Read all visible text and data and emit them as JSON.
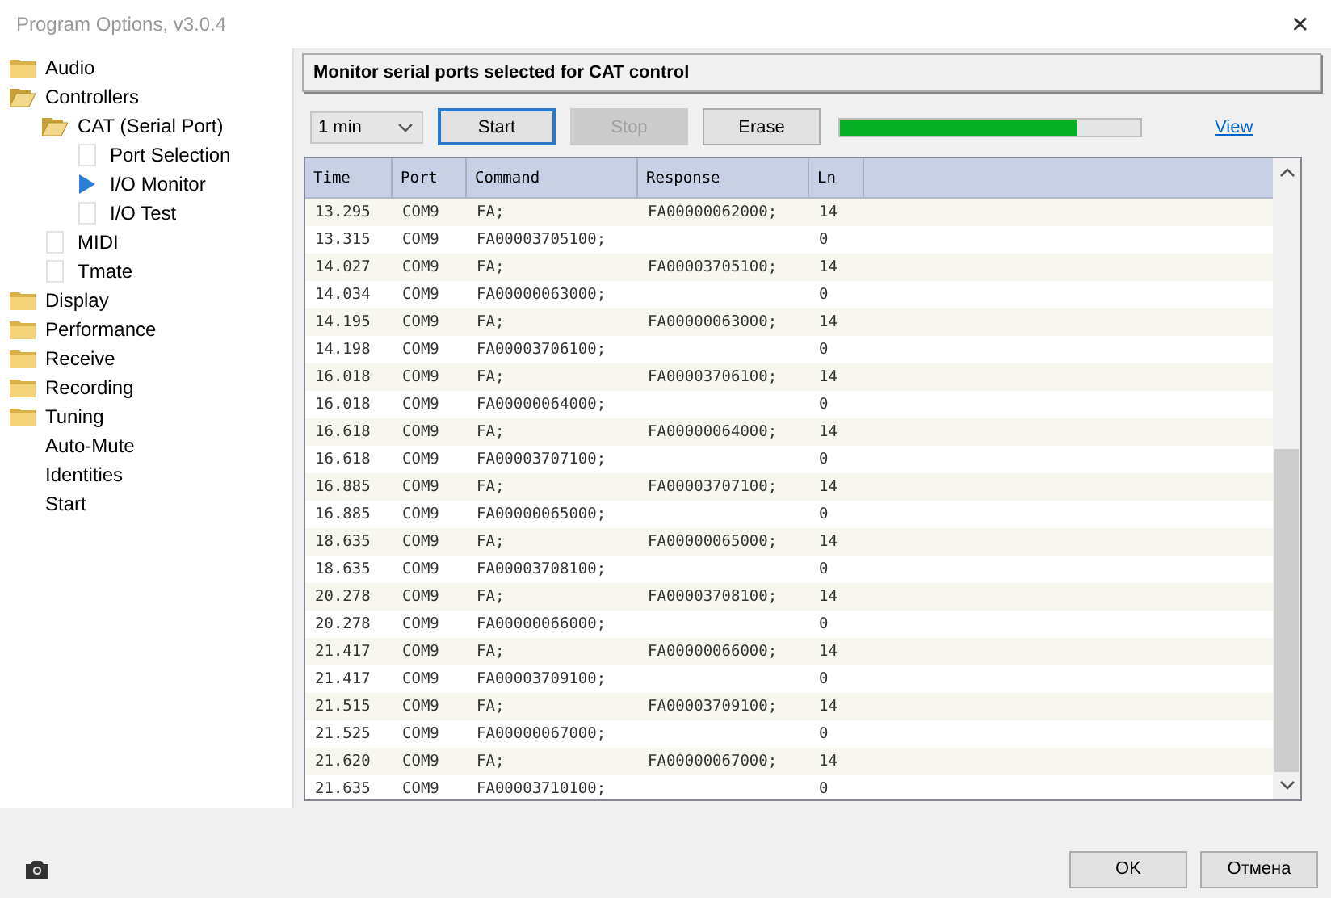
{
  "window": {
    "title": "Program Options, v3.0.4",
    "close": "✕"
  },
  "tree": [
    {
      "label": "Audio",
      "kind": "folder",
      "expanded": false
    },
    {
      "label": "Controllers",
      "kind": "folder",
      "expanded": true,
      "children": [
        {
          "label": "CAT (Serial Port)",
          "kind": "folder",
          "expanded": true,
          "children": [
            {
              "label": "Port Selection",
              "kind": "page",
              "selected": false
            },
            {
              "label": "I/O Monitor",
              "kind": "page",
              "selected": true
            },
            {
              "label": "I/O Test",
              "kind": "page",
              "selected": false
            }
          ]
        },
        {
          "label": "MIDI",
          "kind": "page",
          "selected": false
        },
        {
          "label": "Tmate",
          "kind": "page",
          "selected": false
        }
      ]
    },
    {
      "label": "Display",
      "kind": "folder",
      "expanded": false
    },
    {
      "label": "Performance",
      "kind": "folder",
      "expanded": false
    },
    {
      "label": "Receive",
      "kind": "folder",
      "expanded": false
    },
    {
      "label": "Recording",
      "kind": "folder",
      "expanded": false
    },
    {
      "label": "Tuning",
      "kind": "folder",
      "expanded": false
    },
    {
      "label": "Auto-Mute",
      "kind": "plain"
    },
    {
      "label": "Identities",
      "kind": "plain"
    },
    {
      "label": "Start",
      "kind": "plain"
    }
  ],
  "panel": {
    "heading": "Monitor serial ports selected for CAT control"
  },
  "toolbar": {
    "interval": "1 min",
    "buttons": [
      {
        "label": "Start",
        "disabled": false,
        "focused": true
      },
      {
        "label": "Stop",
        "disabled": true,
        "focused": false
      },
      {
        "label": "Erase",
        "disabled": false,
        "focused": false
      }
    ],
    "progress": {
      "level": 0.79
    },
    "link": "View"
  },
  "table": {
    "columns": [
      "Time",
      "Port",
      "Command",
      "Response",
      "Ln"
    ],
    "rows": [
      [
        "13.295",
        "COM9",
        "FA;",
        "FA00000062000;",
        "14"
      ],
      [
        "13.315",
        "COM9",
        "FA00003705100;",
        "",
        "0"
      ],
      [
        "14.027",
        "COM9",
        "FA;",
        "FA00003705100;",
        "14"
      ],
      [
        "14.034",
        "COM9",
        "FA00000063000;",
        "",
        "0"
      ],
      [
        "14.195",
        "COM9",
        "FA;",
        "FA00000063000;",
        "14"
      ],
      [
        "14.198",
        "COM9",
        "FA00003706100;",
        "",
        "0"
      ],
      [
        "16.018",
        "COM9",
        "FA;",
        "FA00003706100;",
        "14"
      ],
      [
        "16.018",
        "COM9",
        "FA00000064000;",
        "",
        "0"
      ],
      [
        "16.618",
        "COM9",
        "FA;",
        "FA00000064000;",
        "14"
      ],
      [
        "16.618",
        "COM9",
        "FA00003707100;",
        "",
        "0"
      ],
      [
        "16.885",
        "COM9",
        "FA;",
        "FA00003707100;",
        "14"
      ],
      [
        "16.885",
        "COM9",
        "FA00000065000;",
        "",
        "0"
      ],
      [
        "18.635",
        "COM9",
        "FA;",
        "FA00000065000;",
        "14"
      ],
      [
        "18.635",
        "COM9",
        "FA00003708100;",
        "",
        "0"
      ],
      [
        "20.278",
        "COM9",
        "FA;",
        "FA00003708100;",
        "14"
      ],
      [
        "20.278",
        "COM9",
        "FA00000066000;",
        "",
        "0"
      ],
      [
        "21.417",
        "COM9",
        "FA;",
        "FA00000066000;",
        "14"
      ],
      [
        "21.417",
        "COM9",
        "FA00003709100;",
        "",
        "0"
      ],
      [
        "21.515",
        "COM9",
        "FA;",
        "FA00003709100;",
        "14"
      ],
      [
        "21.525",
        "COM9",
        "FA00000067000;",
        "",
        "0"
      ],
      [
        "21.620",
        "COM9",
        "FA;",
        "FA00000067000;",
        "14"
      ],
      [
        "21.635",
        "COM9",
        "FA00003710100;",
        "",
        "0"
      ]
    ]
  },
  "footer": {
    "buttons": [
      "OK",
      "Отмена"
    ]
  }
}
